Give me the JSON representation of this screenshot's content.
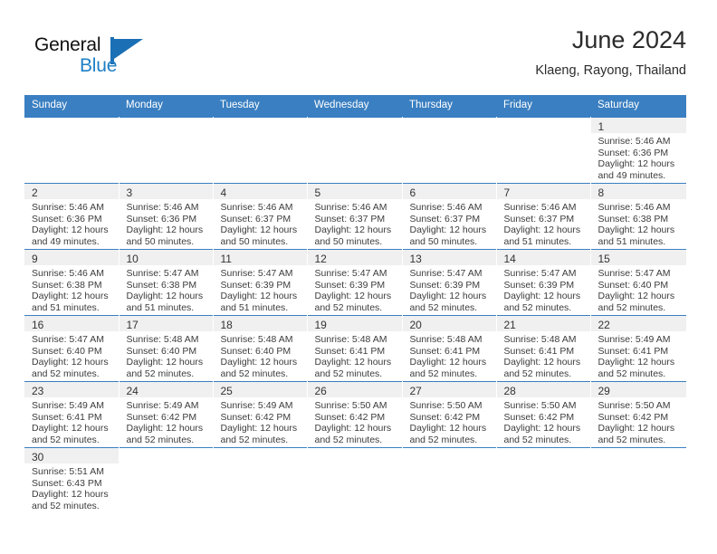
{
  "logo": {
    "word_general": "General",
    "word_blue": "Blue",
    "mark_name": "general-blue-flag-logo"
  },
  "header": {
    "month_title": "June 2024",
    "location": "Klaeng, Rayong, Thailand"
  },
  "calendar": {
    "weekday_headers": [
      "Sunday",
      "Monday",
      "Tuesday",
      "Wednesday",
      "Thursday",
      "Friday",
      "Saturday"
    ],
    "accent_color": "#3a7fc1",
    "daynum_band_color": "#f0f0f0",
    "weeks": [
      [
        {
          "blank": true
        },
        {
          "blank": true
        },
        {
          "blank": true
        },
        {
          "blank": true
        },
        {
          "blank": true
        },
        {
          "blank": true
        },
        {
          "day": "1",
          "sunrise": "Sunrise: 5:46 AM",
          "sunset": "Sunset: 6:36 PM",
          "daylight1": "Daylight: 12 hours",
          "daylight2": "and 49 minutes."
        }
      ],
      [
        {
          "day": "2",
          "sunrise": "Sunrise: 5:46 AM",
          "sunset": "Sunset: 6:36 PM",
          "daylight1": "Daylight: 12 hours",
          "daylight2": "and 49 minutes."
        },
        {
          "day": "3",
          "sunrise": "Sunrise: 5:46 AM",
          "sunset": "Sunset: 6:36 PM",
          "daylight1": "Daylight: 12 hours",
          "daylight2": "and 50 minutes."
        },
        {
          "day": "4",
          "sunrise": "Sunrise: 5:46 AM",
          "sunset": "Sunset: 6:37 PM",
          "daylight1": "Daylight: 12 hours",
          "daylight2": "and 50 minutes."
        },
        {
          "day": "5",
          "sunrise": "Sunrise: 5:46 AM",
          "sunset": "Sunset: 6:37 PM",
          "daylight1": "Daylight: 12 hours",
          "daylight2": "and 50 minutes."
        },
        {
          "day": "6",
          "sunrise": "Sunrise: 5:46 AM",
          "sunset": "Sunset: 6:37 PM",
          "daylight1": "Daylight: 12 hours",
          "daylight2": "and 50 minutes."
        },
        {
          "day": "7",
          "sunrise": "Sunrise: 5:46 AM",
          "sunset": "Sunset: 6:37 PM",
          "daylight1": "Daylight: 12 hours",
          "daylight2": "and 51 minutes."
        },
        {
          "day": "8",
          "sunrise": "Sunrise: 5:46 AM",
          "sunset": "Sunset: 6:38 PM",
          "daylight1": "Daylight: 12 hours",
          "daylight2": "and 51 minutes."
        }
      ],
      [
        {
          "day": "9",
          "sunrise": "Sunrise: 5:46 AM",
          "sunset": "Sunset: 6:38 PM",
          "daylight1": "Daylight: 12 hours",
          "daylight2": "and 51 minutes."
        },
        {
          "day": "10",
          "sunrise": "Sunrise: 5:47 AM",
          "sunset": "Sunset: 6:38 PM",
          "daylight1": "Daylight: 12 hours",
          "daylight2": "and 51 minutes."
        },
        {
          "day": "11",
          "sunrise": "Sunrise: 5:47 AM",
          "sunset": "Sunset: 6:39 PM",
          "daylight1": "Daylight: 12 hours",
          "daylight2": "and 51 minutes."
        },
        {
          "day": "12",
          "sunrise": "Sunrise: 5:47 AM",
          "sunset": "Sunset: 6:39 PM",
          "daylight1": "Daylight: 12 hours",
          "daylight2": "and 52 minutes."
        },
        {
          "day": "13",
          "sunrise": "Sunrise: 5:47 AM",
          "sunset": "Sunset: 6:39 PM",
          "daylight1": "Daylight: 12 hours",
          "daylight2": "and 52 minutes."
        },
        {
          "day": "14",
          "sunrise": "Sunrise: 5:47 AM",
          "sunset": "Sunset: 6:39 PM",
          "daylight1": "Daylight: 12 hours",
          "daylight2": "and 52 minutes."
        },
        {
          "day": "15",
          "sunrise": "Sunrise: 5:47 AM",
          "sunset": "Sunset: 6:40 PM",
          "daylight1": "Daylight: 12 hours",
          "daylight2": "and 52 minutes."
        }
      ],
      [
        {
          "day": "16",
          "sunrise": "Sunrise: 5:47 AM",
          "sunset": "Sunset: 6:40 PM",
          "daylight1": "Daylight: 12 hours",
          "daylight2": "and 52 minutes."
        },
        {
          "day": "17",
          "sunrise": "Sunrise: 5:48 AM",
          "sunset": "Sunset: 6:40 PM",
          "daylight1": "Daylight: 12 hours",
          "daylight2": "and 52 minutes."
        },
        {
          "day": "18",
          "sunrise": "Sunrise: 5:48 AM",
          "sunset": "Sunset: 6:40 PM",
          "daylight1": "Daylight: 12 hours",
          "daylight2": "and 52 minutes."
        },
        {
          "day": "19",
          "sunrise": "Sunrise: 5:48 AM",
          "sunset": "Sunset: 6:41 PM",
          "daylight1": "Daylight: 12 hours",
          "daylight2": "and 52 minutes."
        },
        {
          "day": "20",
          "sunrise": "Sunrise: 5:48 AM",
          "sunset": "Sunset: 6:41 PM",
          "daylight1": "Daylight: 12 hours",
          "daylight2": "and 52 minutes."
        },
        {
          "day": "21",
          "sunrise": "Sunrise: 5:48 AM",
          "sunset": "Sunset: 6:41 PM",
          "daylight1": "Daylight: 12 hours",
          "daylight2": "and 52 minutes."
        },
        {
          "day": "22",
          "sunrise": "Sunrise: 5:49 AM",
          "sunset": "Sunset: 6:41 PM",
          "daylight1": "Daylight: 12 hours",
          "daylight2": "and 52 minutes."
        }
      ],
      [
        {
          "day": "23",
          "sunrise": "Sunrise: 5:49 AM",
          "sunset": "Sunset: 6:41 PM",
          "daylight1": "Daylight: 12 hours",
          "daylight2": "and 52 minutes."
        },
        {
          "day": "24",
          "sunrise": "Sunrise: 5:49 AM",
          "sunset": "Sunset: 6:42 PM",
          "daylight1": "Daylight: 12 hours",
          "daylight2": "and 52 minutes."
        },
        {
          "day": "25",
          "sunrise": "Sunrise: 5:49 AM",
          "sunset": "Sunset: 6:42 PM",
          "daylight1": "Daylight: 12 hours",
          "daylight2": "and 52 minutes."
        },
        {
          "day": "26",
          "sunrise": "Sunrise: 5:50 AM",
          "sunset": "Sunset: 6:42 PM",
          "daylight1": "Daylight: 12 hours",
          "daylight2": "and 52 minutes."
        },
        {
          "day": "27",
          "sunrise": "Sunrise: 5:50 AM",
          "sunset": "Sunset: 6:42 PM",
          "daylight1": "Daylight: 12 hours",
          "daylight2": "and 52 minutes."
        },
        {
          "day": "28",
          "sunrise": "Sunrise: 5:50 AM",
          "sunset": "Sunset: 6:42 PM",
          "daylight1": "Daylight: 12 hours",
          "daylight2": "and 52 minutes."
        },
        {
          "day": "29",
          "sunrise": "Sunrise: 5:50 AM",
          "sunset": "Sunset: 6:42 PM",
          "daylight1": "Daylight: 12 hours",
          "daylight2": "and 52 minutes."
        }
      ],
      [
        {
          "day": "30",
          "sunrise": "Sunrise: 5:51 AM",
          "sunset": "Sunset: 6:43 PM",
          "daylight1": "Daylight: 12 hours",
          "daylight2": "and 52 minutes."
        },
        {
          "blank": true
        },
        {
          "blank": true
        },
        {
          "blank": true
        },
        {
          "blank": true
        },
        {
          "blank": true
        },
        {
          "blank": true
        }
      ]
    ]
  }
}
